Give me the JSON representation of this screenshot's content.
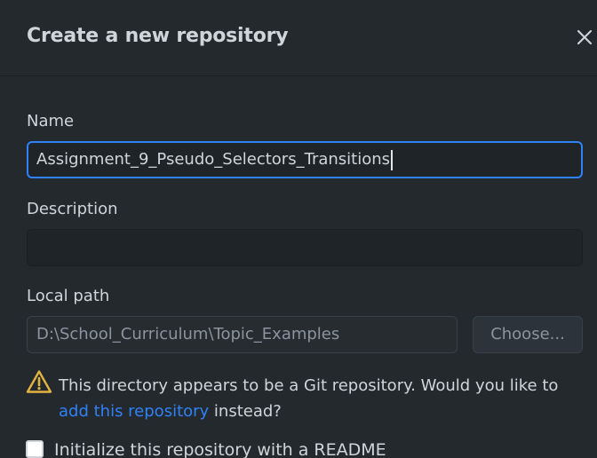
{
  "dialog": {
    "title": "Create a new repository",
    "close_icon": "close-icon"
  },
  "name": {
    "label": "Name",
    "value": "Assignment_9_Pseudo_Selectors_Transitions"
  },
  "description": {
    "label": "Description",
    "value": ""
  },
  "local_path": {
    "label": "Local path",
    "value": "D:\\School_Curriculum\\Topic_Examples",
    "choose_button": "Choose..."
  },
  "warning": {
    "icon": "warning-icon",
    "text_before": "This directory appears to be a Git repository. Would you like to ",
    "link_text": "add this repository",
    "text_after": " instead?"
  },
  "readme": {
    "label": "Initialize this repository with a README",
    "checked": false
  },
  "colors": {
    "background": "#24292e",
    "accent": "#2f81f7",
    "warning": "#e3b341"
  }
}
